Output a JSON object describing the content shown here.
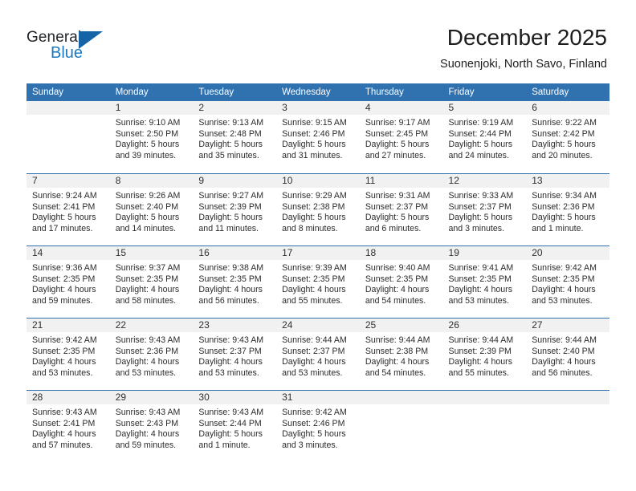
{
  "brand": {
    "name_primary": "General",
    "name_secondary": "Blue",
    "accent_color": "#1c79c0",
    "triangle_color": "#1663a8"
  },
  "header": {
    "title": "December 2025",
    "subtitle": "Suonenjoki, North Savo, Finland"
  },
  "calendar": {
    "header_background": "#3071b0",
    "daynum_background": "#f1f1f1",
    "weekday_headers": [
      "Sunday",
      "Monday",
      "Tuesday",
      "Wednesday",
      "Thursday",
      "Friday",
      "Saturday"
    ],
    "weeks": [
      [
        {
          "day": "",
          "lines": []
        },
        {
          "day": "1",
          "lines": [
            "Sunrise: 9:10 AM",
            "Sunset: 2:50 PM",
            "Daylight: 5 hours",
            "and 39 minutes."
          ]
        },
        {
          "day": "2",
          "lines": [
            "Sunrise: 9:13 AM",
            "Sunset: 2:48 PM",
            "Daylight: 5 hours",
            "and 35 minutes."
          ]
        },
        {
          "day": "3",
          "lines": [
            "Sunrise: 9:15 AM",
            "Sunset: 2:46 PM",
            "Daylight: 5 hours",
            "and 31 minutes."
          ]
        },
        {
          "day": "4",
          "lines": [
            "Sunrise: 9:17 AM",
            "Sunset: 2:45 PM",
            "Daylight: 5 hours",
            "and 27 minutes."
          ]
        },
        {
          "day": "5",
          "lines": [
            "Sunrise: 9:19 AM",
            "Sunset: 2:44 PM",
            "Daylight: 5 hours",
            "and 24 minutes."
          ]
        },
        {
          "day": "6",
          "lines": [
            "Sunrise: 9:22 AM",
            "Sunset: 2:42 PM",
            "Daylight: 5 hours",
            "and 20 minutes."
          ]
        }
      ],
      [
        {
          "day": "7",
          "lines": [
            "Sunrise: 9:24 AM",
            "Sunset: 2:41 PM",
            "Daylight: 5 hours",
            "and 17 minutes."
          ]
        },
        {
          "day": "8",
          "lines": [
            "Sunrise: 9:26 AM",
            "Sunset: 2:40 PM",
            "Daylight: 5 hours",
            "and 14 minutes."
          ]
        },
        {
          "day": "9",
          "lines": [
            "Sunrise: 9:27 AM",
            "Sunset: 2:39 PM",
            "Daylight: 5 hours",
            "and 11 minutes."
          ]
        },
        {
          "day": "10",
          "lines": [
            "Sunrise: 9:29 AM",
            "Sunset: 2:38 PM",
            "Daylight: 5 hours",
            "and 8 minutes."
          ]
        },
        {
          "day": "11",
          "lines": [
            "Sunrise: 9:31 AM",
            "Sunset: 2:37 PM",
            "Daylight: 5 hours",
            "and 6 minutes."
          ]
        },
        {
          "day": "12",
          "lines": [
            "Sunrise: 9:33 AM",
            "Sunset: 2:37 PM",
            "Daylight: 5 hours",
            "and 3 minutes."
          ]
        },
        {
          "day": "13",
          "lines": [
            "Sunrise: 9:34 AM",
            "Sunset: 2:36 PM",
            "Daylight: 5 hours",
            "and 1 minute."
          ]
        }
      ],
      [
        {
          "day": "14",
          "lines": [
            "Sunrise: 9:36 AM",
            "Sunset: 2:35 PM",
            "Daylight: 4 hours",
            "and 59 minutes."
          ]
        },
        {
          "day": "15",
          "lines": [
            "Sunrise: 9:37 AM",
            "Sunset: 2:35 PM",
            "Daylight: 4 hours",
            "and 58 minutes."
          ]
        },
        {
          "day": "16",
          "lines": [
            "Sunrise: 9:38 AM",
            "Sunset: 2:35 PM",
            "Daylight: 4 hours",
            "and 56 minutes."
          ]
        },
        {
          "day": "17",
          "lines": [
            "Sunrise: 9:39 AM",
            "Sunset: 2:35 PM",
            "Daylight: 4 hours",
            "and 55 minutes."
          ]
        },
        {
          "day": "18",
          "lines": [
            "Sunrise: 9:40 AM",
            "Sunset: 2:35 PM",
            "Daylight: 4 hours",
            "and 54 minutes."
          ]
        },
        {
          "day": "19",
          "lines": [
            "Sunrise: 9:41 AM",
            "Sunset: 2:35 PM",
            "Daylight: 4 hours",
            "and 53 minutes."
          ]
        },
        {
          "day": "20",
          "lines": [
            "Sunrise: 9:42 AM",
            "Sunset: 2:35 PM",
            "Daylight: 4 hours",
            "and 53 minutes."
          ]
        }
      ],
      [
        {
          "day": "21",
          "lines": [
            "Sunrise: 9:42 AM",
            "Sunset: 2:35 PM",
            "Daylight: 4 hours",
            "and 53 minutes."
          ]
        },
        {
          "day": "22",
          "lines": [
            "Sunrise: 9:43 AM",
            "Sunset: 2:36 PM",
            "Daylight: 4 hours",
            "and 53 minutes."
          ]
        },
        {
          "day": "23",
          "lines": [
            "Sunrise: 9:43 AM",
            "Sunset: 2:37 PM",
            "Daylight: 4 hours",
            "and 53 minutes."
          ]
        },
        {
          "day": "24",
          "lines": [
            "Sunrise: 9:44 AM",
            "Sunset: 2:37 PM",
            "Daylight: 4 hours",
            "and 53 minutes."
          ]
        },
        {
          "day": "25",
          "lines": [
            "Sunrise: 9:44 AM",
            "Sunset: 2:38 PM",
            "Daylight: 4 hours",
            "and 54 minutes."
          ]
        },
        {
          "day": "26",
          "lines": [
            "Sunrise: 9:44 AM",
            "Sunset: 2:39 PM",
            "Daylight: 4 hours",
            "and 55 minutes."
          ]
        },
        {
          "day": "27",
          "lines": [
            "Sunrise: 9:44 AM",
            "Sunset: 2:40 PM",
            "Daylight: 4 hours",
            "and 56 minutes."
          ]
        }
      ],
      [
        {
          "day": "28",
          "lines": [
            "Sunrise: 9:43 AM",
            "Sunset: 2:41 PM",
            "Daylight: 4 hours",
            "and 57 minutes."
          ]
        },
        {
          "day": "29",
          "lines": [
            "Sunrise: 9:43 AM",
            "Sunset: 2:43 PM",
            "Daylight: 4 hours",
            "and 59 minutes."
          ]
        },
        {
          "day": "30",
          "lines": [
            "Sunrise: 9:43 AM",
            "Sunset: 2:44 PM",
            "Daylight: 5 hours",
            "and 1 minute."
          ]
        },
        {
          "day": "31",
          "lines": [
            "Sunrise: 9:42 AM",
            "Sunset: 2:46 PM",
            "Daylight: 5 hours",
            "and 3 minutes."
          ]
        },
        {
          "day": "",
          "lines": []
        },
        {
          "day": "",
          "lines": []
        },
        {
          "day": "",
          "lines": []
        }
      ]
    ]
  }
}
